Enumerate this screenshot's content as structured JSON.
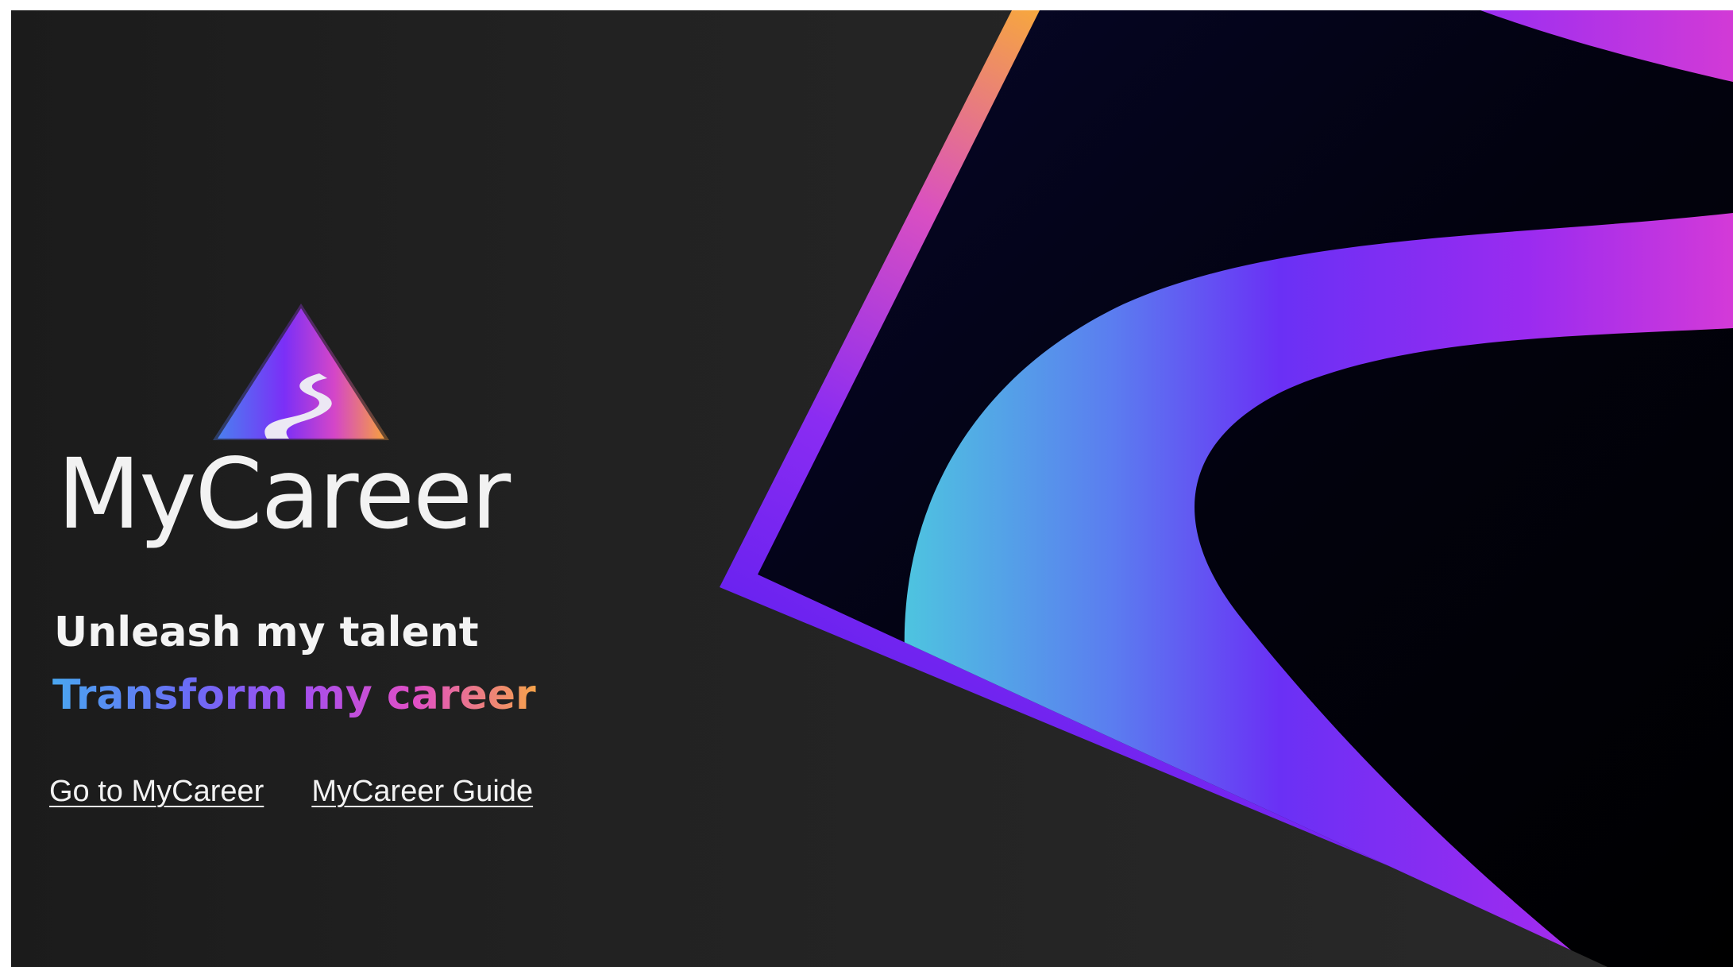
{
  "brand": {
    "name": "MyCareer",
    "logo_icon": "mountain-path-icon"
  },
  "taglines": {
    "line1": "Unleash my talent",
    "line2": "Transform my career"
  },
  "links": {
    "go_to": "Go to MyCareer",
    "guide": "MyCareer Guide"
  },
  "colors": {
    "background": "#222222",
    "text": "#f2f2f2",
    "gradient_blue": "#4aa6f0",
    "gradient_purple": "#7b2ff7",
    "gradient_magenta": "#e04fc6",
    "gradient_orange": "#f6a34a",
    "panel_dark": "#05051a"
  }
}
